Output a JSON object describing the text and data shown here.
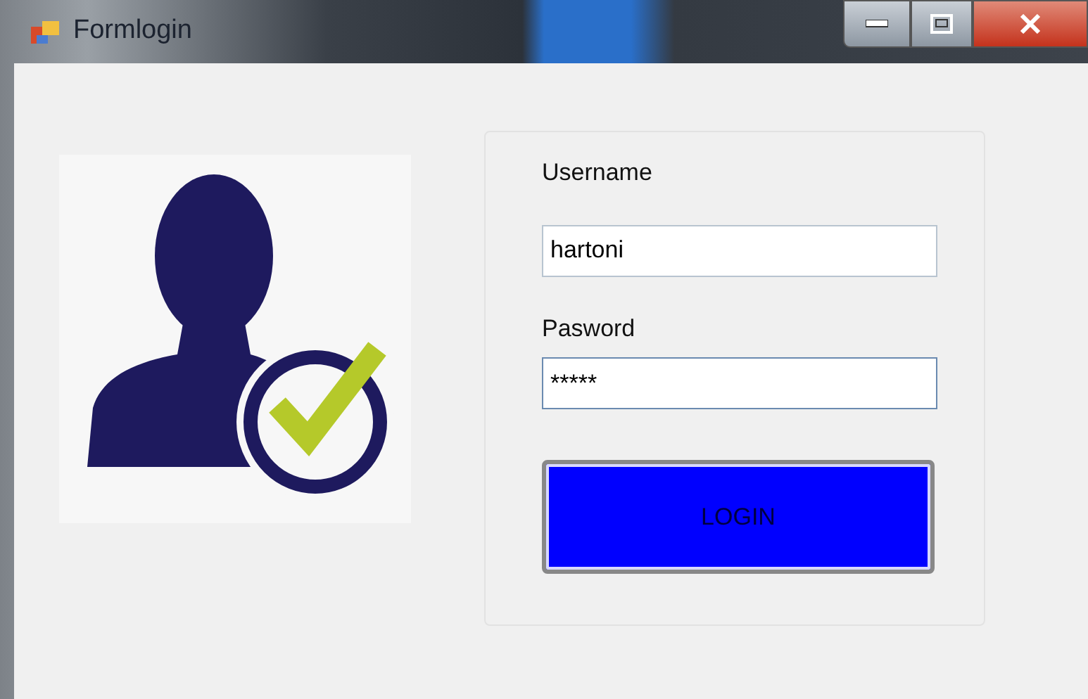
{
  "window": {
    "title": "Formlogin"
  },
  "form": {
    "username_label": "Username",
    "username_value": "hartoni",
    "password_label": "Pasword",
    "password_value": "*****",
    "login_button": "LOGIN"
  }
}
